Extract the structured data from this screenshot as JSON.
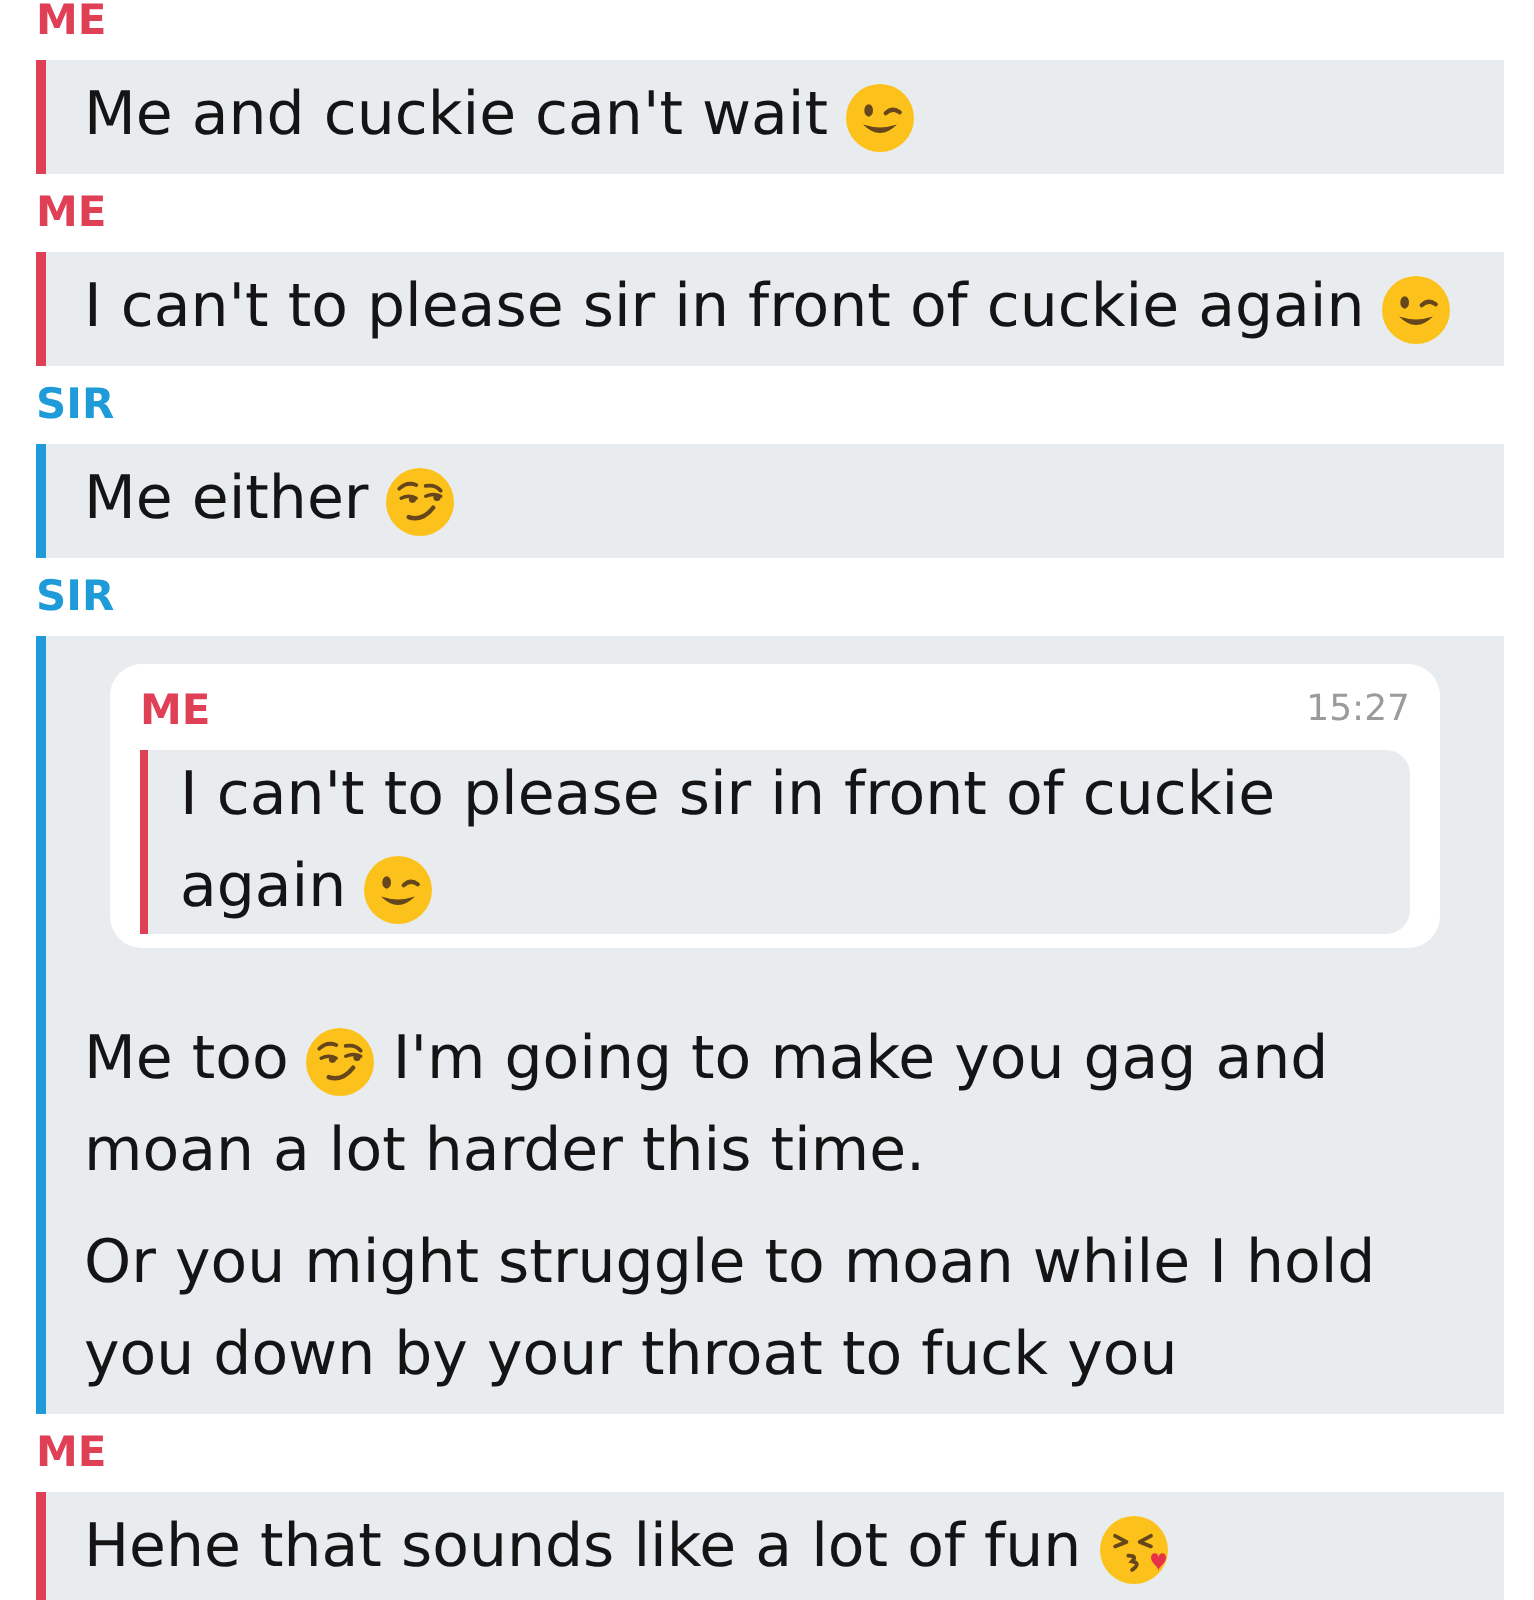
{
  "messages": [
    {
      "sender": "ME",
      "color": "#e04056",
      "paragraphs": [
        {
          "parts": [
            {
              "kind": "text",
              "text": "Me and cuckie can't wait"
            },
            {
              "kind": "wink"
            }
          ]
        }
      ]
    },
    {
      "sender": "ME",
      "color": "#e04056",
      "paragraphs": [
        {
          "parts": [
            {
              "kind": "text",
              "text": "I can't to please sir in front of cuckie again"
            },
            {
              "kind": "wink"
            }
          ]
        }
      ]
    },
    {
      "sender": "SIR",
      "color": "#1e9bd8",
      "paragraphs": [
        {
          "parts": [
            {
              "kind": "text",
              "text": "Me either"
            },
            {
              "kind": "smirk"
            }
          ]
        }
      ]
    },
    {
      "sender": "SIR",
      "color": "#1e9bd8",
      "quote": {
        "sender": "ME",
        "color": "#e04056",
        "time": "15:27",
        "paragraphs": [
          {
            "parts": [
              {
                "kind": "text",
                "text": "I can't to please sir in front of cuckie"
              },
              {
                "kind": "text",
                "text": "again"
              },
              {
                "kind": "wink"
              }
            ]
          }
        ]
      },
      "paragraphs": [
        {
          "parts": [
            {
              "kind": "text",
              "text": "Me too"
            },
            {
              "kind": "smirk"
            },
            {
              "kind": "text",
              "text": "I'm going to make you gag and"
            },
            {
              "kind": "text",
              "text": "moan a lot harder this time."
            }
          ]
        },
        {
          "parts": [
            {
              "kind": "text",
              "text": "Or you might struggle to moan while I hold you down by your throat to fuck you"
            }
          ]
        }
      ]
    },
    {
      "sender": "ME",
      "color": "#e04056",
      "paragraphs": [
        {
          "parts": [
            {
              "kind": "text",
              "text": "Hehe that sounds like a lot of fun"
            },
            {
              "kind": "kiss"
            }
          ]
        }
      ]
    }
  ]
}
